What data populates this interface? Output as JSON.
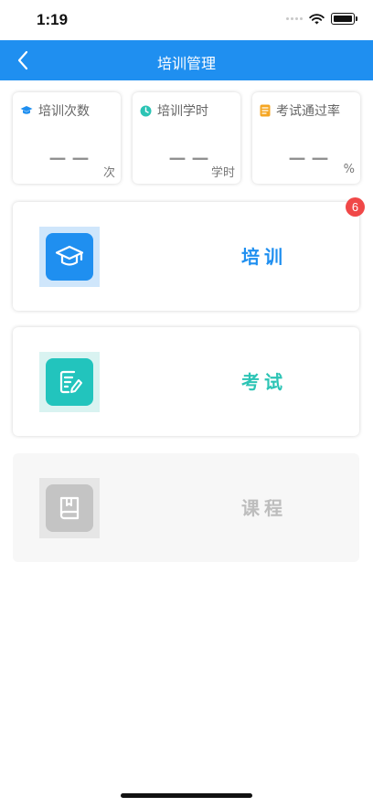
{
  "status_bar": {
    "time": "1:19"
  },
  "nav": {
    "title": "培训管理",
    "back_icon": "chevron-left-icon"
  },
  "stats": [
    {
      "label": "培训次数",
      "value": "－－",
      "unit": "次",
      "icon": "graduation-cap-icon",
      "icon_color": "#1f8ff0"
    },
    {
      "label": "培训学时",
      "value": "－－",
      "unit": "学时",
      "icon": "clock-icon",
      "icon_color": "#2cc4b5"
    },
    {
      "label": "考试通过率",
      "value": "－－",
      "unit": "%",
      "icon": "document-icon",
      "icon_color": "#f5a623"
    }
  ],
  "menu": [
    {
      "label": "培训",
      "icon": "graduation-cap-icon",
      "color": "#1f8ff0",
      "tile_bg": "#1f8ff0",
      "box_bg": "#cfe6fb",
      "badge": "6",
      "enabled": true
    },
    {
      "label": "考试",
      "icon": "edit-document-icon",
      "color": "#2cc4b5",
      "tile_bg": "#22c4bd",
      "box_bg": "#d9f3f1",
      "enabled": true
    },
    {
      "label": "课程",
      "icon": "book-icon",
      "color": "#bdbdbd",
      "tile_bg": "#c4c4c4",
      "box_bg": "#e6e6e6",
      "enabled": false
    }
  ]
}
